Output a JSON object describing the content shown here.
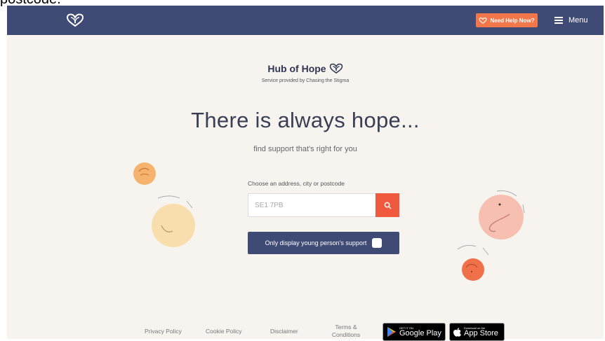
{
  "top_cut_text": "postcode.",
  "header": {
    "help_label": "Need Help Now?",
    "menu_label": "Menu"
  },
  "brand": {
    "title": "Hub of Hope",
    "subtitle": "Service provided by Chasing the Stigma"
  },
  "hero": {
    "heading": "There is always hope...",
    "tagline": "find support that's right for you"
  },
  "search": {
    "label": "Choose an address, city or postcode",
    "value": "SE1 7PB"
  },
  "young_toggle": {
    "label": "Only display young person's support",
    "checked": false
  },
  "footer": {
    "links": [
      "Privacy Policy",
      "Cookie Policy",
      "Disclaimer",
      "Terms & Conditions"
    ],
    "google_play": {
      "small": "GET IT ON",
      "big": "Google Play"
    },
    "app_store": {
      "small": "Download on the",
      "big": "App Store"
    }
  },
  "colors": {
    "nav": "#3f4b74",
    "accent": "#f2784b",
    "search_button": "#f0593d",
    "background": "#f7f4ef"
  }
}
